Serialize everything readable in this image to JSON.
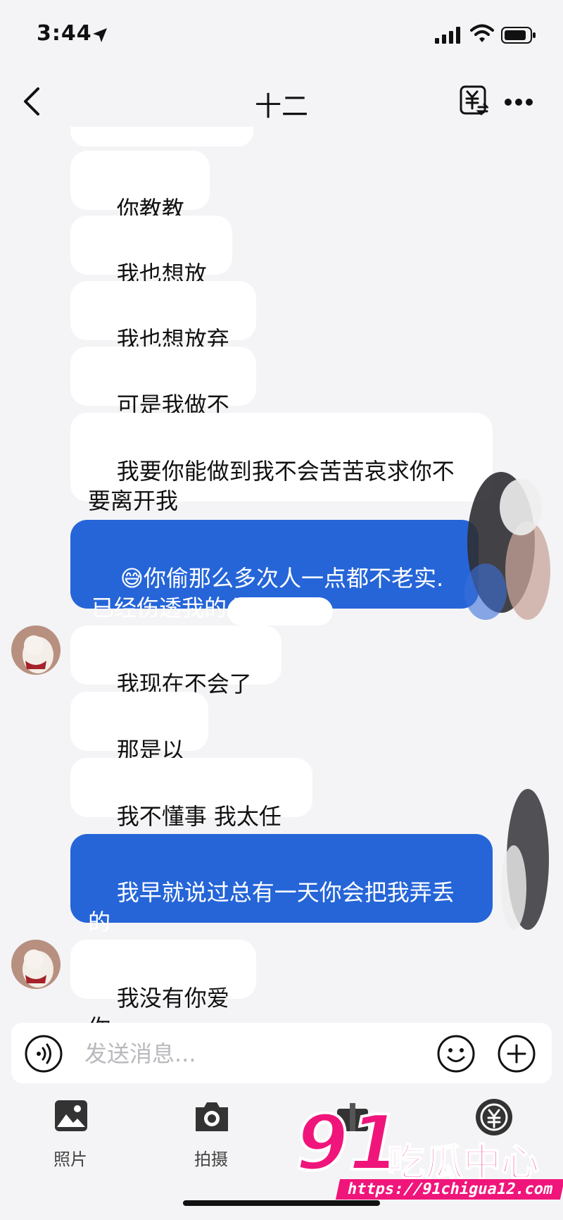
{
  "status_bar": {
    "time": "3:44"
  },
  "header": {
    "title": "十二",
    "transfer_icon": "yen-transfer-icon"
  },
  "messages": [
    {
      "side": "in",
      "text": "你教教我"
    },
    {
      "side": "in",
      "text": "我也想放下"
    },
    {
      "side": "in",
      "text": "我也想放弃你"
    },
    {
      "side": "in",
      "text": "可是我做不到"
    },
    {
      "side": "in",
      "text": "我要你能做到我不会苦苦哀求你不\n要离开我"
    },
    {
      "side": "out",
      "emoji": "😅",
      "text": "你偷那么多次人一点都不老实.\n已经伤透我的心"
    },
    {
      "side": "in",
      "text": "我现在不会了啊"
    },
    {
      "side": "in",
      "text": "那是以前"
    },
    {
      "side": "in",
      "text": "我不懂事 我太任性"
    },
    {
      "side": "out",
      "text": "我早就说过总有一天你会把我弄丢\n的"
    },
    {
      "side": "in",
      "text": "我没有你爱你"
    }
  ],
  "input": {
    "placeholder": "发送消息...",
    "value": ""
  },
  "toolbar": {
    "photo_label": "照片",
    "camera_label": "拍摄"
  },
  "watermark": {
    "logo": "91",
    "name": "吃瓜中心",
    "url": "https://91chigua12.com"
  },
  "colors": {
    "outgoing_bubble": "#2565d8",
    "incoming_bubble": "#ffffff",
    "background": "#f4f4f6",
    "watermark": "#f0157a"
  }
}
